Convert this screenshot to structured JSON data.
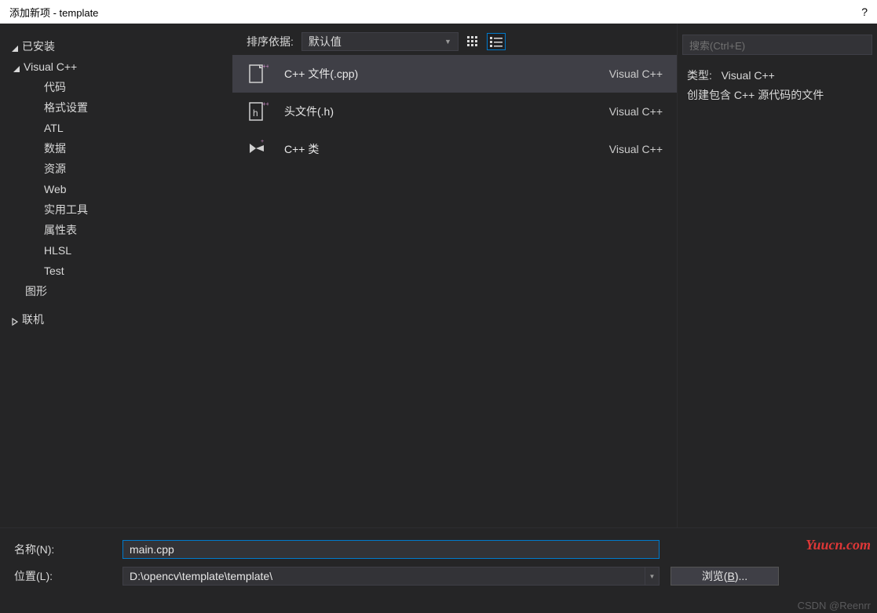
{
  "title": "添加新项 - template",
  "help_icon": "?",
  "sidebar": {
    "installed": "已安装",
    "visual_cpp": "Visual C++",
    "children": [
      "代码",
      "格式设置",
      "ATL",
      "数据",
      "资源",
      "Web",
      "实用工具",
      "属性表",
      "HLSL",
      "Test"
    ],
    "graphics": "图形",
    "online": "联机"
  },
  "toolbar": {
    "sort_label": "排序依据:",
    "sort_value": "默认值"
  },
  "templates": [
    {
      "name": "C++ 文件(.cpp)",
      "lang": "Visual C++",
      "icon": "cpp-file",
      "selected": true
    },
    {
      "name": "头文件(.h)",
      "lang": "Visual C++",
      "icon": "h-file",
      "selected": false
    },
    {
      "name": "C++ 类",
      "lang": "Visual C++",
      "icon": "cpp-class",
      "selected": false
    }
  ],
  "search": {
    "placeholder": "搜索(Ctrl+E)"
  },
  "info": {
    "type_label": "类型:",
    "type_value": "Visual C++",
    "description": "创建包含 C++ 源代码的文件"
  },
  "form": {
    "name_label": "名称(N):",
    "name_value": "main.cpp",
    "location_label": "位置(L):",
    "location_value": "D:\\opencv\\template\\template\\",
    "browse_label_pre": "浏览(",
    "browse_label_u": "B",
    "browse_label_post": ")..."
  },
  "watermark1": "Yuucn.com",
  "watermark2": "CSDN @Reenrr"
}
